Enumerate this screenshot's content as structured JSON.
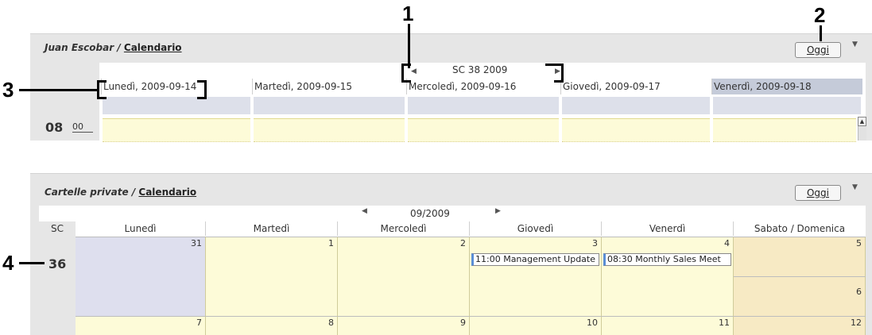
{
  "callouts": [
    "1",
    "2",
    "3",
    "4"
  ],
  "week_panel": {
    "title_user": "Juan Escobar",
    "title_sep": " / ",
    "title_link": "Calendario",
    "today_button": "Oggi",
    "nav_label": "SC 38 2009",
    "days": [
      "Lunedì, 2009-09-14",
      "Martedì, 2009-09-15",
      "Mercoledì, 2009-09-16",
      "Giovedì, 2009-09-17",
      "Venerdì, 2009-09-18"
    ],
    "hour": "08",
    "minute": "00"
  },
  "month_panel": {
    "title_folder": "Cartelle private",
    "title_sep": " / ",
    "title_link": "Calendario",
    "today_button": "Oggi",
    "nav_label": "09/2009",
    "week_col_header": "SC",
    "columns": [
      "Lunedì",
      "Martedì",
      "Mercoledì",
      "Giovedì",
      "Venerdì",
      "Sabato / Domenica"
    ],
    "week_36": {
      "label": "36",
      "days": [
        "31",
        "1",
        "2",
        "3",
        "4"
      ],
      "saturday": "5",
      "sunday": "6",
      "events": {
        "thursday": "11:00 Management Update",
        "friday": "08:30 Monthly Sales Meet"
      }
    },
    "week_37": {
      "days": [
        "7",
        "8",
        "9",
        "10",
        "11",
        "12"
      ]
    }
  }
}
